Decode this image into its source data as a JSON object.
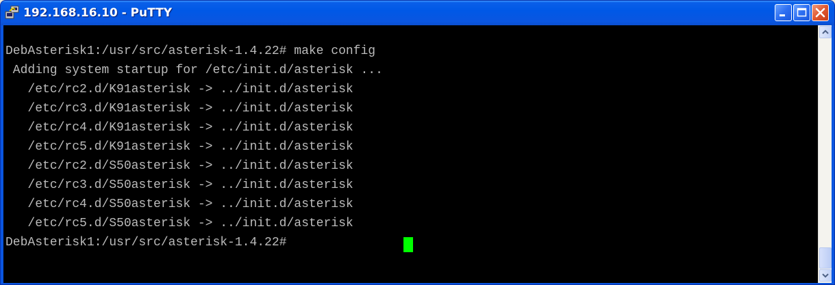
{
  "window": {
    "title": "192.168.16.10 - PuTTY",
    "app_icon": "putty-icon",
    "controls": [
      "minimize-icon",
      "maximize-icon",
      "close-icon"
    ]
  },
  "terminal": {
    "lines": [
      "DebAsterisk1:/usr/src/asterisk-1.4.22# make config",
      " Adding system startup for /etc/init.d/asterisk ...",
      "   /etc/rc2.d/K91asterisk -> ../init.d/asterisk",
      "   /etc/rc3.d/K91asterisk -> ../init.d/asterisk",
      "   /etc/rc4.d/K91asterisk -> ../init.d/asterisk",
      "   /etc/rc5.d/K91asterisk -> ../init.d/asterisk",
      "   /etc/rc2.d/S50asterisk -> ../init.d/asterisk",
      "   /etc/rc3.d/S50asterisk -> ../init.d/asterisk",
      "   /etc/rc4.d/S50asterisk -> ../init.d/asterisk",
      "   /etc/rc5.d/S50asterisk -> ../init.d/asterisk",
      "DebAsterisk1:/usr/src/asterisk-1.4.22# "
    ],
    "text_color": "#bbbbbb",
    "background": "#000000",
    "cursor_color": "#00ff00"
  },
  "scrollbar": {
    "up_icon": "scroll-up-arrow-icon",
    "down_icon": "scroll-down-arrow-icon"
  }
}
